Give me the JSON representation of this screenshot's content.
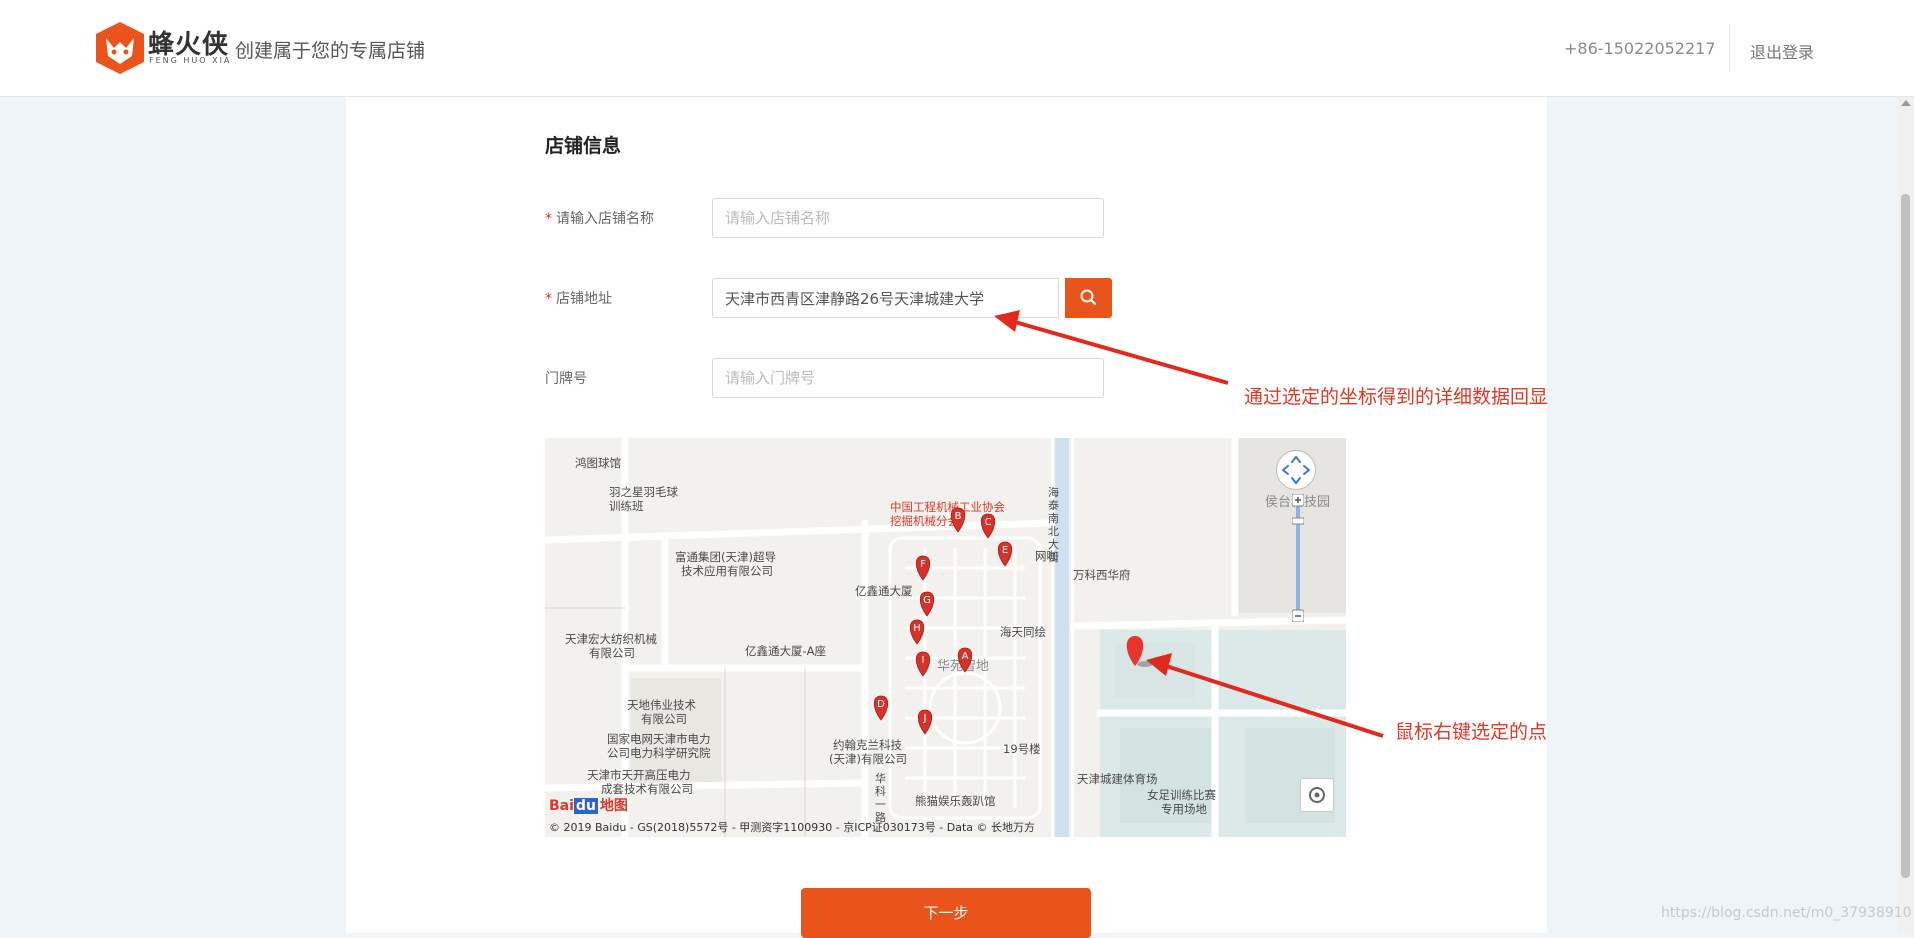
{
  "header": {
    "logo_text": "蜂火侠",
    "logo_sub": "FENG HUO XIA",
    "slogan": "创建属于您的专属店铺",
    "phone": "+86-15022052217",
    "logout": "退出登录"
  },
  "form": {
    "section_title": "店铺信息",
    "shop_name_label": "请输入店铺名称",
    "shop_name_placeholder": "请输入店铺名称",
    "address_label": "店铺地址",
    "address_value": "天津市西青区津静路26号天津城建大学",
    "door_label": "门牌号",
    "door_placeholder": "请输入门牌号",
    "required_mark": "*",
    "next_button": "下一步"
  },
  "map": {
    "copyright": "© 2019 Baidu - GS(2018)5572号 - 甲测资字1100930 - 京ICP证030173号 - Data © 长地万方",
    "logo_a": "Bai",
    "logo_b": "du",
    "logo_c": "地图",
    "labels": {
      "l1": "鸿图球馆",
      "l2": "羽之星羽毛球",
      "l2b": "训练班",
      "l3": "中国工程机械工业协会",
      "l3b": "挖掘机械分会",
      "l4": "富通集团(天津)超导",
      "l4b": "技术应用有限公司",
      "l5": "网咖",
      "l6": "万科西华府",
      "l7": "亿鑫通大厦",
      "l8": "海天同绘",
      "l9": "天津宏大纺织机械",
      "l9b": "有限公司",
      "l10": "亿鑫通大厦-A座",
      "l11": "华苑智地",
      "l12": "天地伟业技术",
      "l12b": "有限公司",
      "l13": "国家电网天津市电力",
      "l13b": "公司电力科学研究院",
      "l14": "约翰克兰科技",
      "l14b": "(天津)有限公司",
      "l15": "19号楼",
      "l16": "天津市天开高压电力",
      "l16b": "成套技术有限公司",
      "l17": "熊猫娱乐轰趴馆",
      "l18": "天津城建体育场",
      "l19": "女足训练比赛",
      "l19b": "专用场地",
      "l20": "侯台科技园",
      "road": "海泰南北大街",
      "road2": "华科一路"
    },
    "markers": [
      "A",
      "B",
      "C",
      "D",
      "E",
      "F",
      "G",
      "H",
      "I",
      "J"
    ]
  },
  "annotations": {
    "a1": "通过选定的坐标得到的详细数据回显",
    "a2": "鼠标右键选定的点"
  },
  "watermark": "https://blog.csdn.net/m0_37938910",
  "colors": {
    "accent": "#e8541b",
    "annotation": "#d93a2a",
    "marker": "#d6322a"
  }
}
